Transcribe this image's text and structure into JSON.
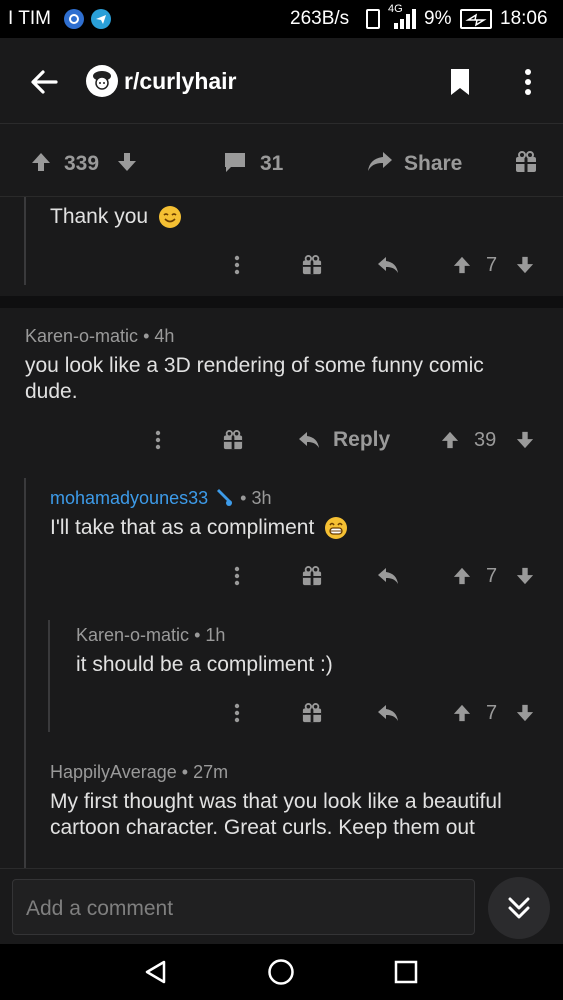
{
  "status_bar": {
    "carrier": "I TIM",
    "speed": "263B/s",
    "network": "4G",
    "battery": "9%",
    "time": "18:06"
  },
  "header": {
    "subreddit": "r/curlyhair"
  },
  "post_bar": {
    "upvotes": "339",
    "comments": "31",
    "share_label": "Share"
  },
  "comments": [
    {
      "body": "Thank you",
      "votes": "7"
    },
    {
      "author": "Karen-o-matic",
      "age": "4h",
      "body": "you look like a 3D rendering of some funny comic dude.",
      "reply_label": "Reply",
      "votes": "39"
    },
    {
      "author": "mohamadyounes33",
      "age": "3h",
      "body": "I'll take that as a compliment",
      "votes": "7"
    },
    {
      "author": "Karen-o-matic",
      "age": "1h",
      "body": "it should be a compliment :)",
      "votes": "7"
    },
    {
      "author": "HappilyAverage",
      "age": "27m",
      "body": "My first thought was that you look like a beautiful cartoon character. Great curls. Keep them out"
    }
  ],
  "comment_input": {
    "placeholder": "Add a comment"
  },
  "colors": {
    "background": "#1a1a1b",
    "op_username": "#3d9be9",
    "emoji": "#f5c033"
  }
}
